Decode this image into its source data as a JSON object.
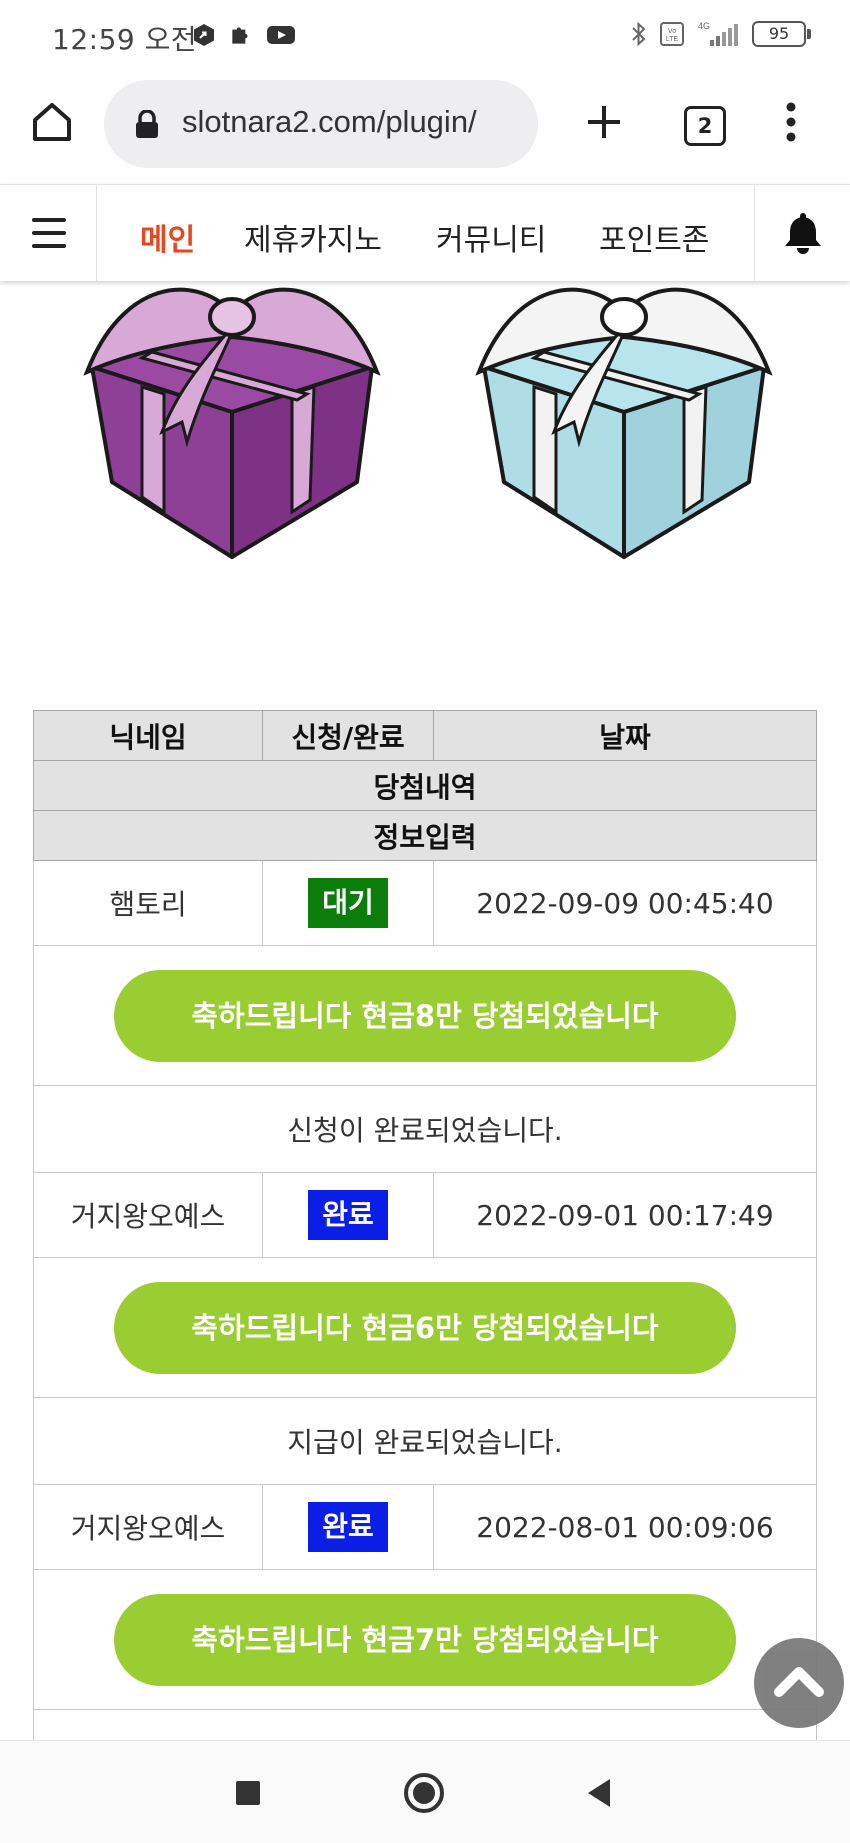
{
  "status": {
    "time": "12:59 오전",
    "battery": "95",
    "network": "4G"
  },
  "browser": {
    "url": "slotnara2.com/plugin/",
    "tab_count": "2"
  },
  "nav": {
    "items": [
      "메인",
      "제휴카지노",
      "커뮤니티",
      "포인트존"
    ],
    "active_color": "#e8461c"
  },
  "gifts": [
    {
      "name": "purple-gift",
      "box_color": "#8e3f96",
      "ribbon_color": "#d8a9d6"
    },
    {
      "name": "blue-gift",
      "box_color": "#aedde6",
      "ribbon_color": "#f2f2f2"
    }
  ],
  "table": {
    "headers": {
      "nickname": "닉네임",
      "status": "신청/완료",
      "date": "날짜"
    },
    "sub_headers": [
      "당첨내역",
      "정보입력"
    ],
    "entries": [
      {
        "nickname": "햄토리",
        "status": "대기",
        "status_color": "#0a7d0a",
        "date": "2022-09-09 00:45:40",
        "prize": "축하드립니다 현금8만 당첨되었습니다",
        "message": "신청이 완료되었습니다."
      },
      {
        "nickname": "거지왕오예스",
        "status": "완료",
        "status_color": "#0a1ee6",
        "date": "2022-09-01 00:17:49",
        "prize": "축하드립니다 현금6만 당첨되었습니다",
        "message": "지급이 완료되었습니다."
      },
      {
        "nickname": "거지왕오예스",
        "status": "완료",
        "status_color": "#0a1ee6",
        "date": "2022-08-01 00:09:06",
        "prize": "축하드립니다 현금7만 당첨되었습니다",
        "message": ""
      }
    ],
    "prize_color": "#9acd32"
  }
}
